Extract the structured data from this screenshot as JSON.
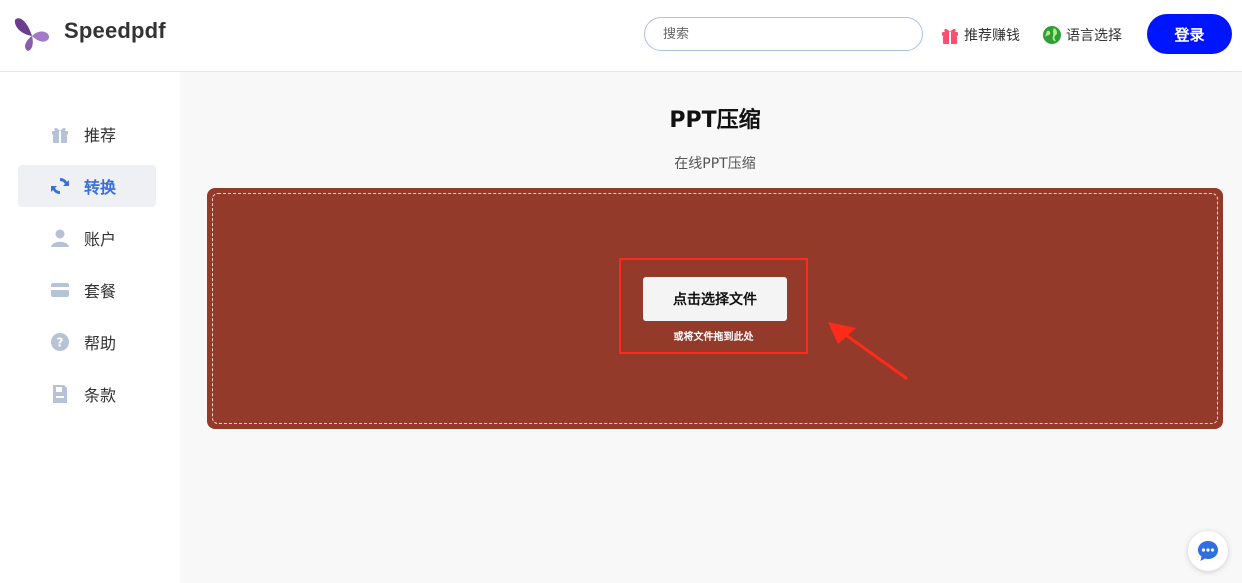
{
  "header": {
    "brand": "Speedpdf",
    "search_placeholder": "搜索",
    "referral_label": "推荐赚钱",
    "language_label": "语言选择",
    "login_label": "登录"
  },
  "sidebar": {
    "items": [
      {
        "label": "推荐",
        "icon": "gift-icon"
      },
      {
        "label": "转换",
        "icon": "sync-icon"
      },
      {
        "label": "账户",
        "icon": "user-icon"
      },
      {
        "label": "套餐",
        "icon": "card-icon"
      },
      {
        "label": "帮助",
        "icon": "help-icon"
      },
      {
        "label": "条款",
        "icon": "document-icon"
      }
    ],
    "active_index": 1
  },
  "main": {
    "title": "PPT压缩",
    "subtitle": "在线PPT压缩",
    "choose_label": "点击选择文件",
    "drag_hint": "或将文件拖到此处"
  },
  "colors": {
    "accent": "#0015ff",
    "dropzone": "#943a2b",
    "highlight": "#ff2a1a",
    "active_text": "#3b6fd8"
  }
}
